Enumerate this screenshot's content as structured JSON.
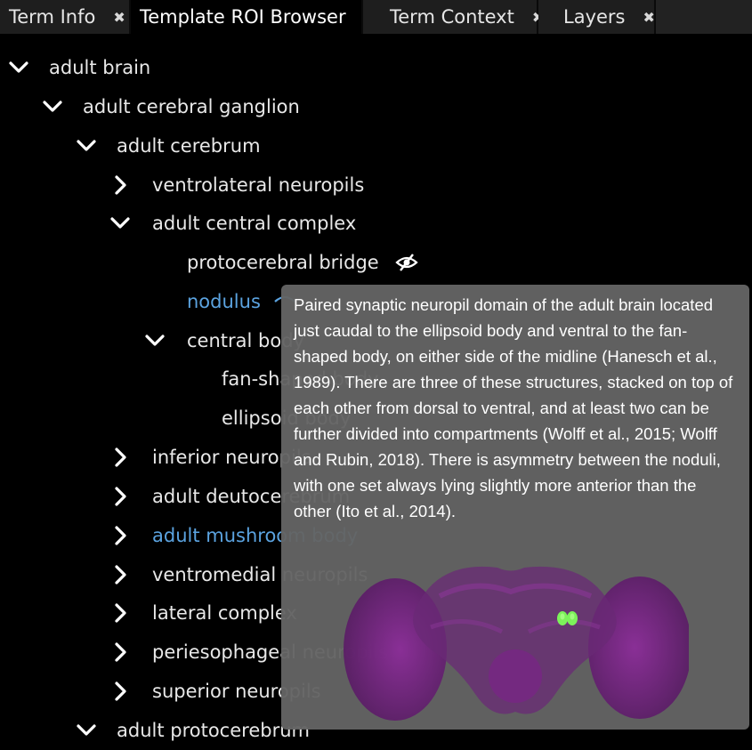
{
  "tabs": [
    {
      "label": "Term Info",
      "active": false
    },
    {
      "label": "Template ROI Browser",
      "active": true
    },
    {
      "label": "Term Context",
      "active": false
    },
    {
      "label": "Layers",
      "active": false
    }
  ],
  "tab_close_glyph": "✖",
  "tree": {
    "rows": [
      {
        "label": "adult brain",
        "state": "expanded"
      },
      {
        "label": "adult cerebral ganglion",
        "state": "expanded"
      },
      {
        "label": "adult cerebrum",
        "state": "expanded"
      },
      {
        "label": "ventrolateral neuropils",
        "state": "collapsed"
      },
      {
        "label": "adult central complex",
        "state": "expanded"
      },
      {
        "label": "protocerebral bridge",
        "state": "leaf",
        "visibility": "hidden"
      },
      {
        "label": "nodulus",
        "state": "leaf",
        "highlighted": true
      },
      {
        "label": "central body",
        "state": "expanded"
      },
      {
        "label": "fan-shaped body",
        "state": "leaf"
      },
      {
        "label": "ellipsoid body",
        "state": "leaf"
      },
      {
        "label": "inferior neuropils",
        "state": "collapsed"
      },
      {
        "label": "adult deutocerebrum",
        "state": "collapsed"
      },
      {
        "label": "adult mushroom body",
        "state": "collapsed",
        "highlighted": true
      },
      {
        "label": "ventromedial neuropils",
        "state": "collapsed"
      },
      {
        "label": "lateral complex",
        "state": "collapsed"
      },
      {
        "label": "periesophageal neuropils",
        "state": "collapsed"
      },
      {
        "label": "superior neuropils",
        "state": "collapsed"
      },
      {
        "label": "adult protocerebrum",
        "state": "expanded"
      }
    ]
  },
  "tooltip": {
    "text": "Paired synaptic neuropil domain of the adult brain located just caudal to the ellipsoid body and ventral to the fan-shaped body, on either side of the midline (Hanesch et al., 1989). There are three of these structures, stacked on top of each other from dorsal to ventral, and at least two can be further divided into compartments (Wolff et al., 2015; Wolff and Rubin, 2018). There is asymmetry between the noduli, with one set always lying slightly more anterior than the other (Ito et al., 2014).",
    "thumbnail_icon": "brain-thumbnail-icon"
  },
  "colors": {
    "link": "#5ba3e0",
    "background": "#000000",
    "tooltip_bg": "#646464",
    "brain": "#7a1f86",
    "highlight": "#7cf25a"
  }
}
